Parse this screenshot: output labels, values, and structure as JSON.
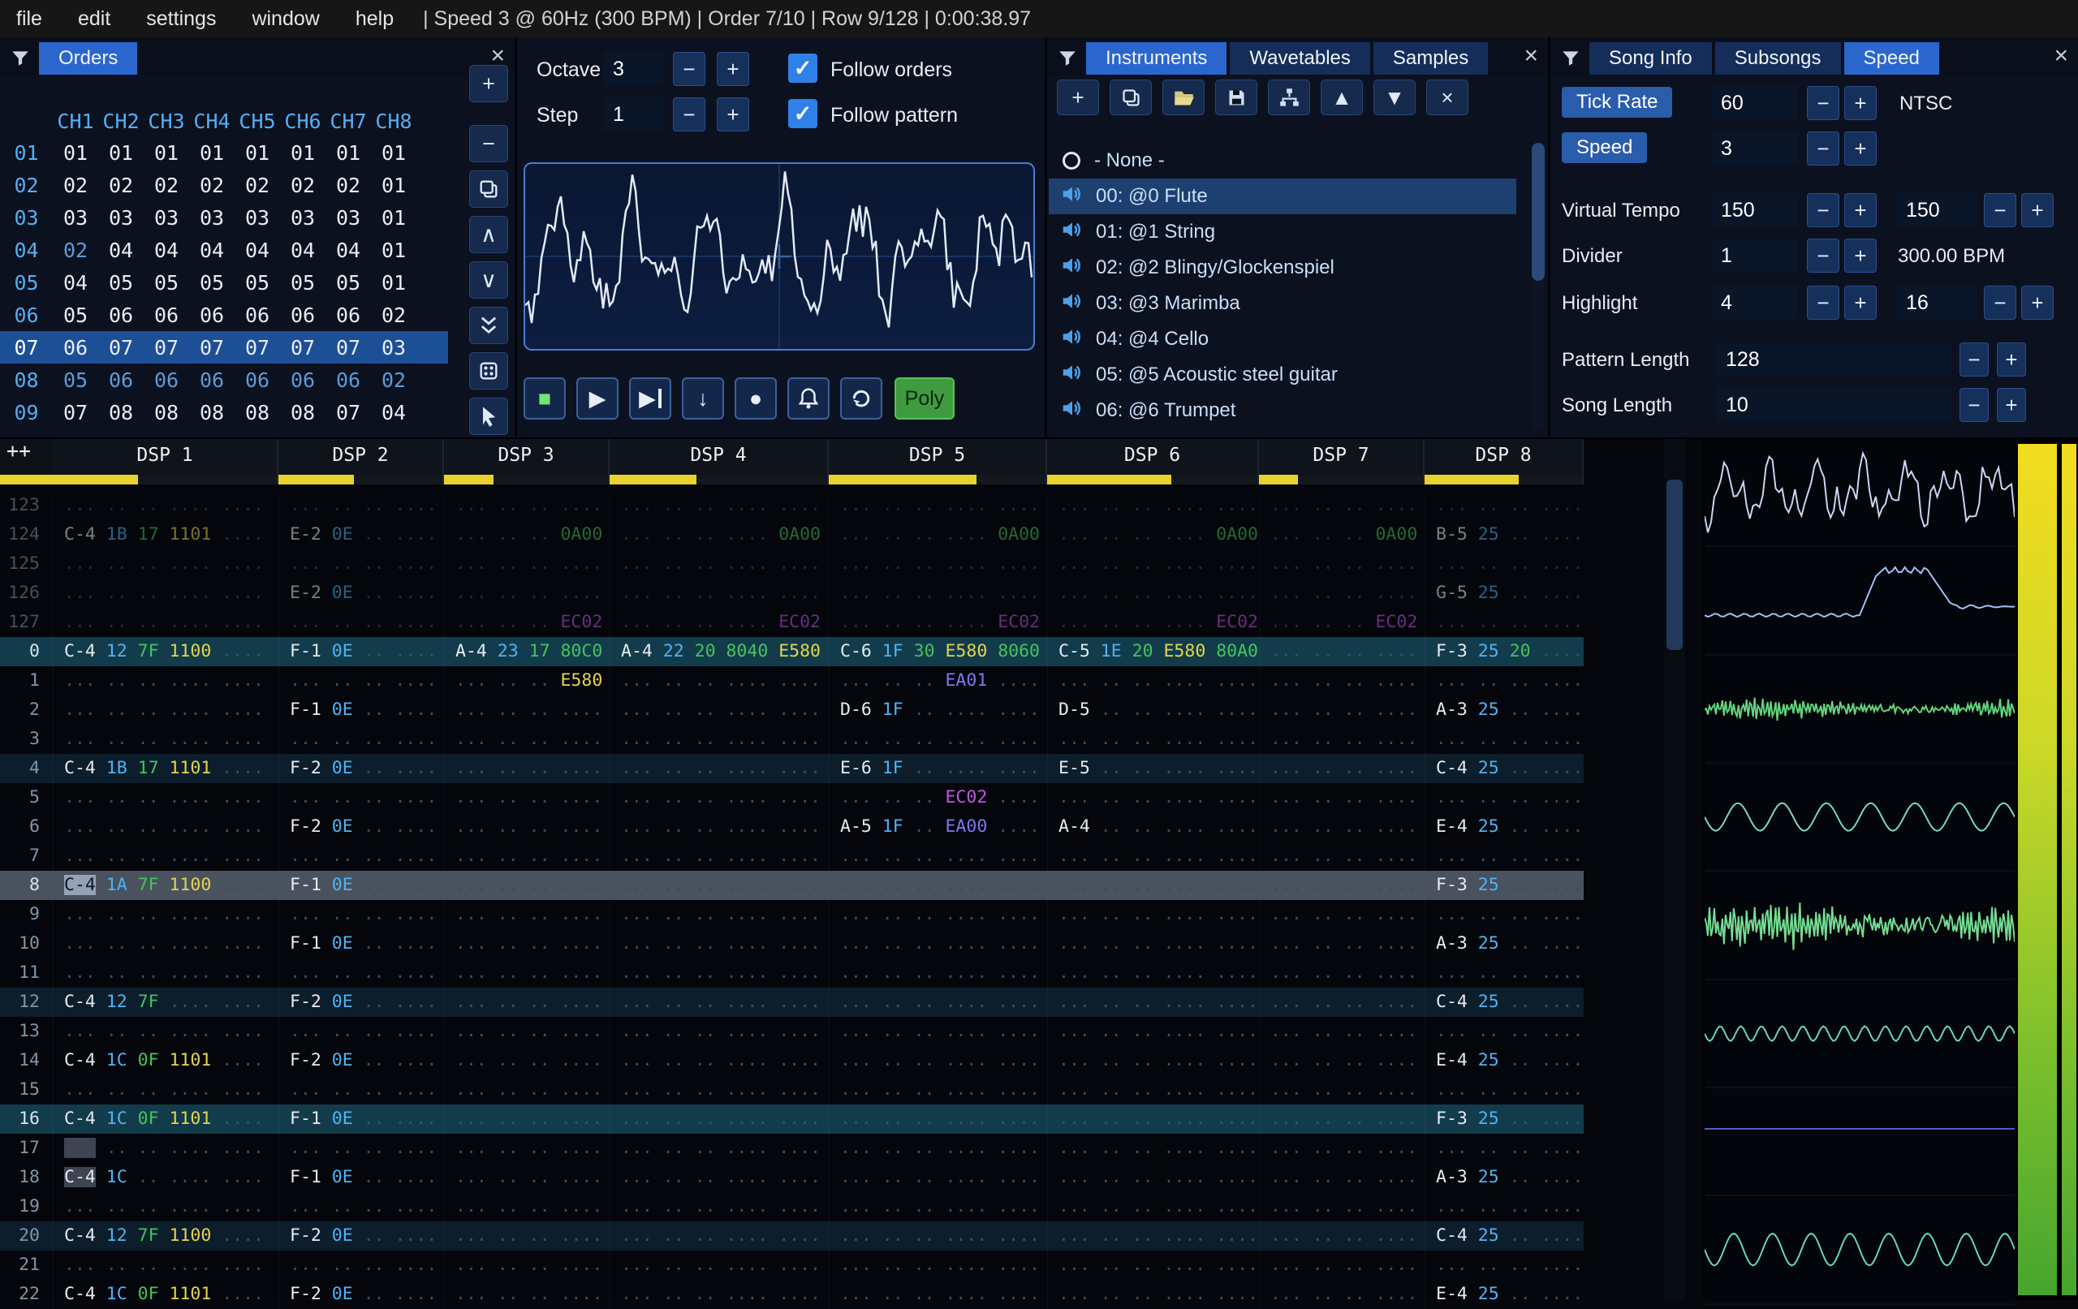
{
  "ui": {
    "minus": "−",
    "plus": "+",
    "check": "✓",
    "close": "×"
  },
  "menu": {
    "items": [
      "file",
      "edit",
      "settings",
      "window",
      "help"
    ],
    "status": "| Speed 3 @ 60Hz (300 BPM) | Order 7/10 | Row 9/128 | 0:00:38.97"
  },
  "orders": {
    "title": "Orders",
    "headers": [
      "CH1",
      "CH2",
      "CH3",
      "CH4",
      "CH5",
      "CH6",
      "CH7",
      "CH8"
    ],
    "rows": [
      {
        "idx": "01",
        "vals": [
          "01",
          "01",
          "01",
          "01",
          "01",
          "01",
          "01",
          "01"
        ]
      },
      {
        "idx": "02",
        "vals": [
          "02",
          "02",
          "02",
          "02",
          "02",
          "02",
          "02",
          "01"
        ]
      },
      {
        "idx": "03",
        "vals": [
          "03",
          "03",
          "03",
          "03",
          "03",
          "03",
          "03",
          "01"
        ]
      },
      {
        "idx": "04",
        "vals": [
          "02",
          "04",
          "04",
          "04",
          "04",
          "04",
          "04",
          "01"
        ],
        "dim": [
          0
        ]
      },
      {
        "idx": "05",
        "vals": [
          "04",
          "05",
          "05",
          "05",
          "05",
          "05",
          "05",
          "01"
        ]
      },
      {
        "idx": "06",
        "vals": [
          "05",
          "06",
          "06",
          "06",
          "06",
          "06",
          "06",
          "02"
        ]
      },
      {
        "idx": "07",
        "vals": [
          "06",
          "07",
          "07",
          "07",
          "07",
          "07",
          "07",
          "03"
        ],
        "selected": true
      },
      {
        "idx": "08",
        "vals": [
          "05",
          "06",
          "06",
          "06",
          "06",
          "06",
          "06",
          "02"
        ],
        "dim": [
          0,
          1,
          2,
          3,
          4,
          5,
          6,
          7
        ]
      },
      {
        "idx": "09",
        "vals": [
          "07",
          "08",
          "08",
          "08",
          "08",
          "08",
          "07",
          "04"
        ]
      }
    ],
    "toolbar": [
      {
        "name": "add-order-button",
        "icon": "plus"
      },
      {
        "name": "remove-order-button",
        "icon": "minus"
      },
      {
        "name": "duplicate-order-button",
        "icon": "copy"
      },
      {
        "name": "move-order-up-button",
        "icon": "chevu"
      },
      {
        "name": "move-order-down-button",
        "icon": "chevd"
      },
      {
        "name": "duplicate-order-end-button",
        "icon": "chev2d"
      },
      {
        "name": "deep-clone-order-button",
        "icon": "dice"
      },
      {
        "name": "order-edit-mode-button",
        "icon": "cursor"
      }
    ]
  },
  "playback": {
    "octave_label": "Octave",
    "octave_value": "3",
    "step_label": "Step",
    "step_value": "1",
    "follow_orders_label": "Follow orders",
    "follow_pattern_label": "Follow pattern",
    "poly_label": "Poly",
    "transport": [
      {
        "name": "stop-button",
        "icon": "stop"
      },
      {
        "name": "play-button",
        "icon": "play"
      },
      {
        "name": "play-from-cursor-button",
        "icon": "skip"
      },
      {
        "name": "step-row-button",
        "icon": "stepdown"
      },
      {
        "name": "edit-record-button",
        "icon": "record"
      },
      {
        "name": "metronome-button",
        "icon": "bell"
      },
      {
        "name": "repeat-pattern-button",
        "icon": "repeat"
      }
    ]
  },
  "instruments": {
    "tabs": [
      "Instruments",
      "Wavetables",
      "Samples"
    ],
    "active_tab": "Instruments",
    "none_item": "- None -",
    "items": [
      "00: @0 Flute",
      "01: @1 String",
      "02: @2 Blingy/Glockenspiel",
      "03: @3 Marimba",
      "04: @4 Cello",
      "05: @5 Acoustic steel guitar",
      "06: @6 Trumpet"
    ],
    "selected_item": "00: @0 Flute",
    "toolbar": [
      {
        "name": "add-instrument-button",
        "icon": "plus"
      },
      {
        "name": "duplicate-instrument-button",
        "icon": "copy"
      },
      {
        "name": "open-instrument-button",
        "icon": "folder"
      },
      {
        "name": "save-instrument-button",
        "icon": "save"
      },
      {
        "name": "organize-instruments-button",
        "icon": "tree"
      },
      {
        "name": "move-instrument-up-button",
        "icon": "up"
      },
      {
        "name": "move-instrument-down-button",
        "icon": "down"
      },
      {
        "name": "delete-instrument-button",
        "icon": "x"
      }
    ]
  },
  "song": {
    "tabs": [
      "Song Info",
      "Subsongs",
      "Speed"
    ],
    "active_tab": "Speed",
    "tick_rate_label": "Tick Rate",
    "tick_rate_value": "60",
    "tick_rate_mode": "NTSC",
    "speed_label": "Speed",
    "speed_value": "3",
    "virtual_tempo_label": "Virtual Tempo",
    "virtual_tempo_num": "150",
    "virtual_tempo_den": "150",
    "divider_label": "Divider",
    "divider_value": "1",
    "bpm_text": "300.00 BPM",
    "highlight_label": "Highlight",
    "highlight_first": "4",
    "highlight_second": "16",
    "pattern_length_label": "Pattern Length",
    "pattern_length_value": "128",
    "song_length_label": "Song Length",
    "song_length_value": "10"
  },
  "pattern": {
    "corner": "++",
    "channels": [
      {
        "name": "DSP 1",
        "meter_pct": 38
      },
      {
        "name": "DSP 2",
        "meter_pct": 46
      },
      {
        "name": "DSP 3",
        "meter_pct": 30
      },
      {
        "name": "DSP 4",
        "meter_pct": 40
      },
      {
        "name": "DSP 5",
        "meter_pct": 68
      },
      {
        "name": "DSP 6",
        "meter_pct": 59
      },
      {
        "name": "DSP 7",
        "meter_pct": 24
      },
      {
        "name": "DSP 8",
        "meter_pct": 60
      }
    ],
    "rows": [
      {
        "n": "123",
        "cls": "prev",
        "cells": [
          null,
          null,
          null,
          null,
          null,
          null,
          null,
          null
        ]
      },
      {
        "n": "124",
        "cls": "prev",
        "cells": [
          [
            "C-4|n",
            "1B|i",
            "17|v",
            "1101|y",
            null
          ],
          [
            "E-2|n",
            "0E|i",
            null,
            null
          ],
          [
            null,
            null,
            null,
            "0A00|g"
          ],
          [
            null,
            null,
            null,
            null,
            "0A00|g"
          ],
          [
            null,
            null,
            null,
            null,
            "0A00|g"
          ],
          [
            null,
            null,
            null,
            null,
            "0A00|g"
          ],
          [
            null,
            null,
            null,
            "0A00|g"
          ],
          [
            "B-5|n",
            "25|i",
            null,
            null
          ]
        ]
      },
      {
        "n": "125",
        "cls": "prev",
        "cells": [
          null,
          null,
          null,
          null,
          null,
          null,
          null,
          null
        ]
      },
      {
        "n": "126",
        "cls": "prev",
        "cells": [
          null,
          [
            "E-2|n",
            "0E|i",
            null,
            null
          ],
          null,
          null,
          null,
          null,
          null,
          [
            "G-5|n",
            "25|i",
            null,
            null
          ]
        ]
      },
      {
        "n": "127",
        "cls": "prev",
        "cells": [
          null,
          null,
          [
            null,
            null,
            null,
            "EC02|p"
          ],
          [
            null,
            null,
            null,
            null,
            "EC02|p"
          ],
          [
            null,
            null,
            null,
            null,
            "EC02|p"
          ],
          [
            null,
            null,
            null,
            null,
            "EC02|p"
          ],
          [
            null,
            null,
            null,
            "EC02|p"
          ],
          null
        ]
      },
      {
        "n": "0",
        "cls": "hl2",
        "cells": [
          [
            "C-4|n",
            "12|i",
            "7F|v",
            "1100|y",
            null
          ],
          [
            "F-1|n",
            "0E|i",
            null,
            null
          ],
          [
            "A-4|n",
            "23|i",
            "17|v",
            "80C0|g"
          ],
          [
            "A-4|n",
            "22|i",
            "20|v",
            "8040|g",
            "E580|y"
          ],
          [
            "C-6|n",
            "1F|i",
            "30|v",
            "E580|y",
            "8060|g"
          ],
          [
            "C-5|n",
            "1E|i",
            "20|v",
            "E580|y",
            "80A0|g"
          ],
          null,
          [
            "F-3|n",
            "25|i",
            "20|v",
            null
          ]
        ]
      },
      {
        "n": "1",
        "cells": [
          null,
          null,
          [
            null,
            null,
            null,
            "E580|y"
          ],
          null,
          [
            null,
            null,
            null,
            "EA01|b",
            null
          ],
          null,
          null,
          null
        ]
      },
      {
        "n": "2",
        "cells": [
          null,
          [
            "F-1|n",
            "0E|i",
            null,
            null
          ],
          null,
          null,
          [
            "D-6|n",
            "1F|i",
            null,
            null,
            null
          ],
          [
            "D-5|n",
            null,
            null,
            null,
            null
          ],
          null,
          [
            "A-3|n",
            "25|i",
            null,
            null
          ]
        ]
      },
      {
        "n": "3",
        "cells": [
          null,
          null,
          null,
          null,
          null,
          null,
          null,
          null
        ]
      },
      {
        "n": "4",
        "cls": "hl1",
        "cells": [
          [
            "C-4|n",
            "1B|i",
            "17|v",
            "1101|y",
            null
          ],
          [
            "F-2|n",
            "0E|i",
            null,
            null
          ],
          null,
          null,
          [
            "E-6|n",
            "1F|i",
            null,
            null,
            null
          ],
          [
            "E-5|n",
            null,
            null,
            null,
            null
          ],
          null,
          [
            "C-4|n",
            "25|i",
            null,
            null
          ]
        ]
      },
      {
        "n": "5",
        "cells": [
          null,
          null,
          null,
          null,
          [
            null,
            null,
            null,
            "EC02|p",
            null
          ],
          null,
          null,
          null
        ]
      },
      {
        "n": "6",
        "cells": [
          null,
          [
            "F-2|n",
            "0E|i",
            null,
            null
          ],
          null,
          null,
          [
            "A-5|n",
            "1F|i",
            null,
            "EA00|b",
            null
          ],
          [
            "A-4|n",
            null,
            null,
            null,
            null
          ],
          null,
          [
            "E-4|n",
            "25|i",
            null,
            null
          ]
        ]
      },
      {
        "n": "7",
        "cells": [
          null,
          null,
          null,
          null,
          null,
          null,
          null,
          null
        ]
      },
      {
        "n": "8",
        "cls": "cursor",
        "cells": [
          [
            "C-4|n|cur",
            "1A|i",
            "7F|v",
            "1100|y",
            null
          ],
          [
            "F-1|n",
            "0E|i",
            null,
            null
          ],
          null,
          null,
          null,
          null,
          null,
          [
            "F-3|n",
            "25|i",
            null,
            null
          ]
        ]
      },
      {
        "n": "9",
        "cells": [
          null,
          null,
          null,
          null,
          null,
          null,
          null,
          null
        ]
      },
      {
        "n": "10",
        "cells": [
          null,
          [
            "F-1|n",
            "0E|i",
            null,
            null
          ],
          null,
          null,
          null,
          null,
          null,
          [
            "A-3|n",
            "25|i",
            null,
            null
          ]
        ]
      },
      {
        "n": "11",
        "cells": [
          null,
          null,
          null,
          null,
          null,
          null,
          null,
          null
        ]
      },
      {
        "n": "12",
        "cls": "hl1",
        "cells": [
          [
            "C-4|n",
            "12|i",
            "7F|v",
            null,
            null
          ],
          [
            "F-2|n",
            "0E|i",
            null,
            null
          ],
          null,
          null,
          null,
          null,
          null,
          [
            "C-4|n",
            "25|i",
            null,
            null
          ]
        ]
      },
      {
        "n": "13",
        "cells": [
          null,
          null,
          null,
          null,
          null,
          null,
          null,
          null
        ]
      },
      {
        "n": "14",
        "cells": [
          [
            "C-4|n",
            "1C|i",
            "0F|v",
            "1101|y",
            null
          ],
          [
            "F-2|n",
            "0E|i",
            null,
            null
          ],
          null,
          null,
          null,
          null,
          null,
          [
            "E-4|n",
            "25|i",
            null,
            null
          ]
        ]
      },
      {
        "n": "15",
        "cells": [
          null,
          null,
          null,
          null,
          null,
          null,
          null,
          null
        ]
      },
      {
        "n": "16",
        "cls": "hl2",
        "cells": [
          [
            "C-4|n",
            "1C|i",
            "0F|v",
            "1101|y",
            null
          ],
          [
            "F-1|n",
            "0E|i",
            null,
            null
          ],
          null,
          null,
          null,
          null,
          null,
          [
            "F-3|n",
            "25|i",
            null,
            null
          ]
        ]
      },
      {
        "n": "17",
        "cells": [
          [
            "...|d|sel",
            null,
            null,
            null,
            null
          ],
          null,
          null,
          null,
          null,
          null,
          null,
          null
        ]
      },
      {
        "n": "18",
        "cells": [
          [
            "C-4|n|sel",
            "1C|i",
            null,
            null,
            null
          ],
          [
            "F-1|n",
            "0E|i",
            null,
            null
          ],
          null,
          null,
          null,
          null,
          null,
          [
            "A-3|n",
            "25|i",
            null,
            null
          ]
        ]
      },
      {
        "n": "19",
        "cells": [
          null,
          null,
          null,
          null,
          null,
          null,
          null,
          null
        ]
      },
      {
        "n": "20",
        "cls": "hl1",
        "cells": [
          [
            "C-4|n",
            "12|i",
            "7F|v",
            "1100|y",
            null
          ],
          [
            "F-2|n",
            "0E|i",
            null,
            null
          ],
          null,
          null,
          null,
          null,
          null,
          [
            "C-4|n",
            "25|i",
            null,
            null
          ]
        ]
      },
      {
        "n": "21",
        "cells": [
          null,
          null,
          null,
          null,
          null,
          null,
          null,
          null
        ]
      },
      {
        "n": "22",
        "cells": [
          [
            "C-4|n",
            "1C|i",
            "0F|v",
            "1101|y",
            null
          ],
          [
            "F-2|n",
            "0E|i",
            null,
            null
          ],
          null,
          null,
          null,
          null,
          null,
          [
            "E-4|n",
            "25|i",
            null,
            null
          ]
        ]
      }
    ]
  },
  "scopes": [
    {
      "wave": "music",
      "color": "#c9d6f2",
      "amp": 0.5
    },
    {
      "wave": "pulse",
      "color": "#9fc2f4",
      "amp": 0.72
    },
    {
      "wave": "dense",
      "color": "#63d47c",
      "amp": 0.16
    },
    {
      "wave": "sine",
      "color": "#79d8c4",
      "amp": 0.26,
      "freq": 7
    },
    {
      "wave": "dense",
      "color": "#74dc92",
      "amp": 0.34
    },
    {
      "wave": "sine",
      "color": "#6cd4bc",
      "amp": 0.14,
      "freq": 15
    },
    {
      "wave": "flat",
      "color": "#4a66d0",
      "off": -0.12
    },
    {
      "wave": "sine",
      "color": "#66d6c2",
      "amp": 0.3,
      "freq": 8
    }
  ],
  "colors": {
    "channel_meter": "#e8d22e",
    "accent": "#2b66cc",
    "selection": "#1d4f97"
  }
}
